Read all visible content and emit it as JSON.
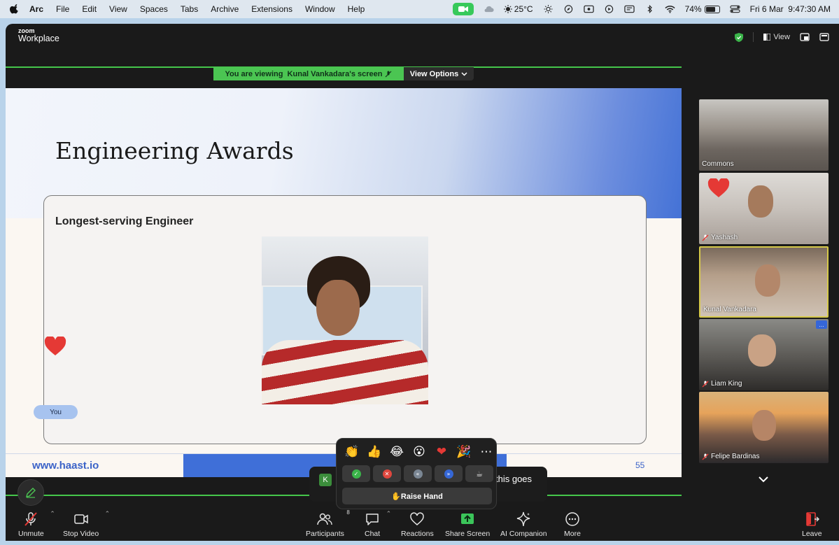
{
  "menubar": {
    "items": [
      "Arc",
      "File",
      "Edit",
      "View",
      "Spaces",
      "Tabs",
      "Archive",
      "Extensions",
      "Window",
      "Help"
    ],
    "weather": "25°C",
    "battery_percent": "74%",
    "battery_level": 0.74,
    "datetime": "Fri 6 Mar  9:47:30 AM"
  },
  "zoom": {
    "brand_top": "zoom",
    "brand_bottom": "Workplace",
    "view_label": "View",
    "viewing_text": "You are viewing  Kunal Vankadara's screen",
    "view_options": "View Options",
    "slide": {
      "title": "Engineering Awards",
      "card_title": "Longest-serving Engineer",
      "footer_url": "www.haast.io",
      "page_number": "55"
    },
    "you_label": "You",
    "caption": {
      "avatar_letter": "K",
      "text": "this goes"
    },
    "reactions": {
      "emojis": [
        "👏",
        "👍",
        "😂",
        "😮",
        "❤",
        "🎉",
        "⋯"
      ],
      "nonverbal_colors": [
        "#3bb54a",
        "#e0473e",
        "#7b8794",
        "#3567d6",
        "#c8c8c8"
      ],
      "raise_hand": "✋Raise Hand"
    },
    "gallery": [
      {
        "name": "Commons",
        "muted": false
      },
      {
        "name": "Yashash",
        "muted": true
      },
      {
        "name": "Kunal Vankadara",
        "muted": false
      },
      {
        "name": "Liam King",
        "muted": true
      },
      {
        "name": "Felipe Bardinas",
        "muted": true
      }
    ],
    "toolbar": {
      "unmute": "Unmute",
      "stop_video": "Stop Video",
      "participants": "Participants",
      "participants_count": "8",
      "chat": "Chat",
      "reactions": "Reactions",
      "share_screen": "Share Screen",
      "ai_companion": "AI Companion",
      "more": "More",
      "leave": "Leave"
    }
  }
}
